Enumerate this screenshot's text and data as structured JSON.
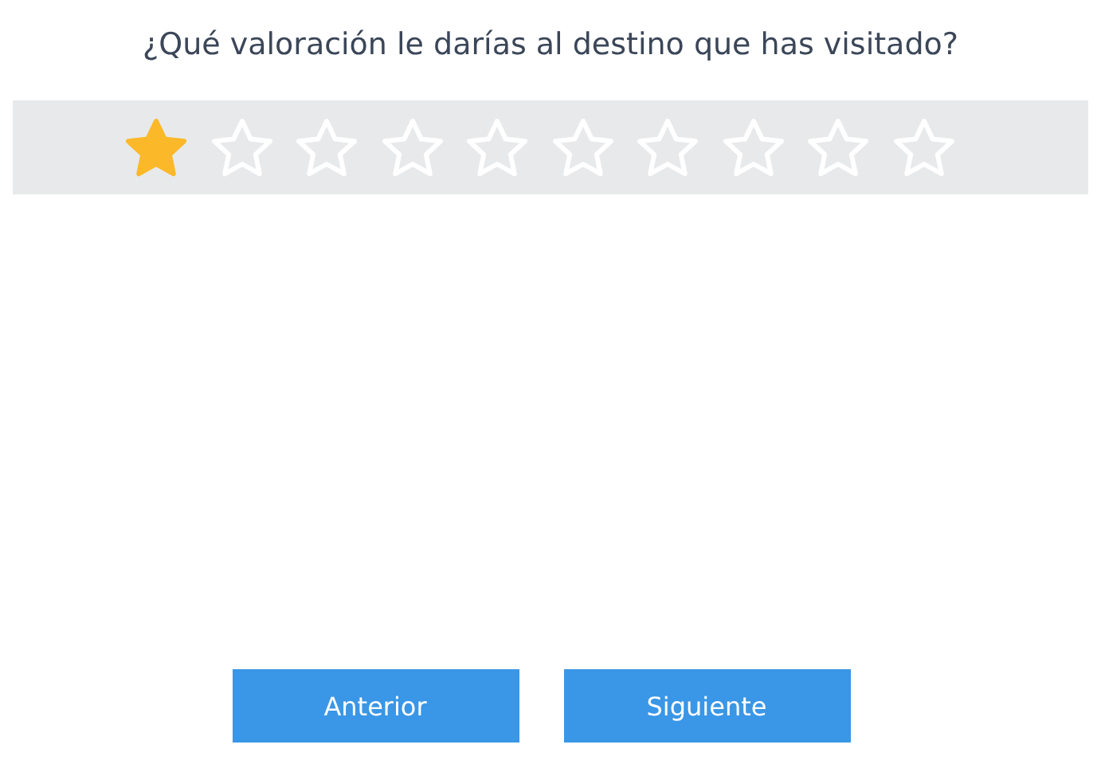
{
  "question": "¿Qué valoración le darías al destino que has visitado?",
  "rating": {
    "stars": 1
  },
  "buttons": [
    {
      "label": "Anterior"
    },
    {
      "label": "Siguiente"
    }
  ]
}
